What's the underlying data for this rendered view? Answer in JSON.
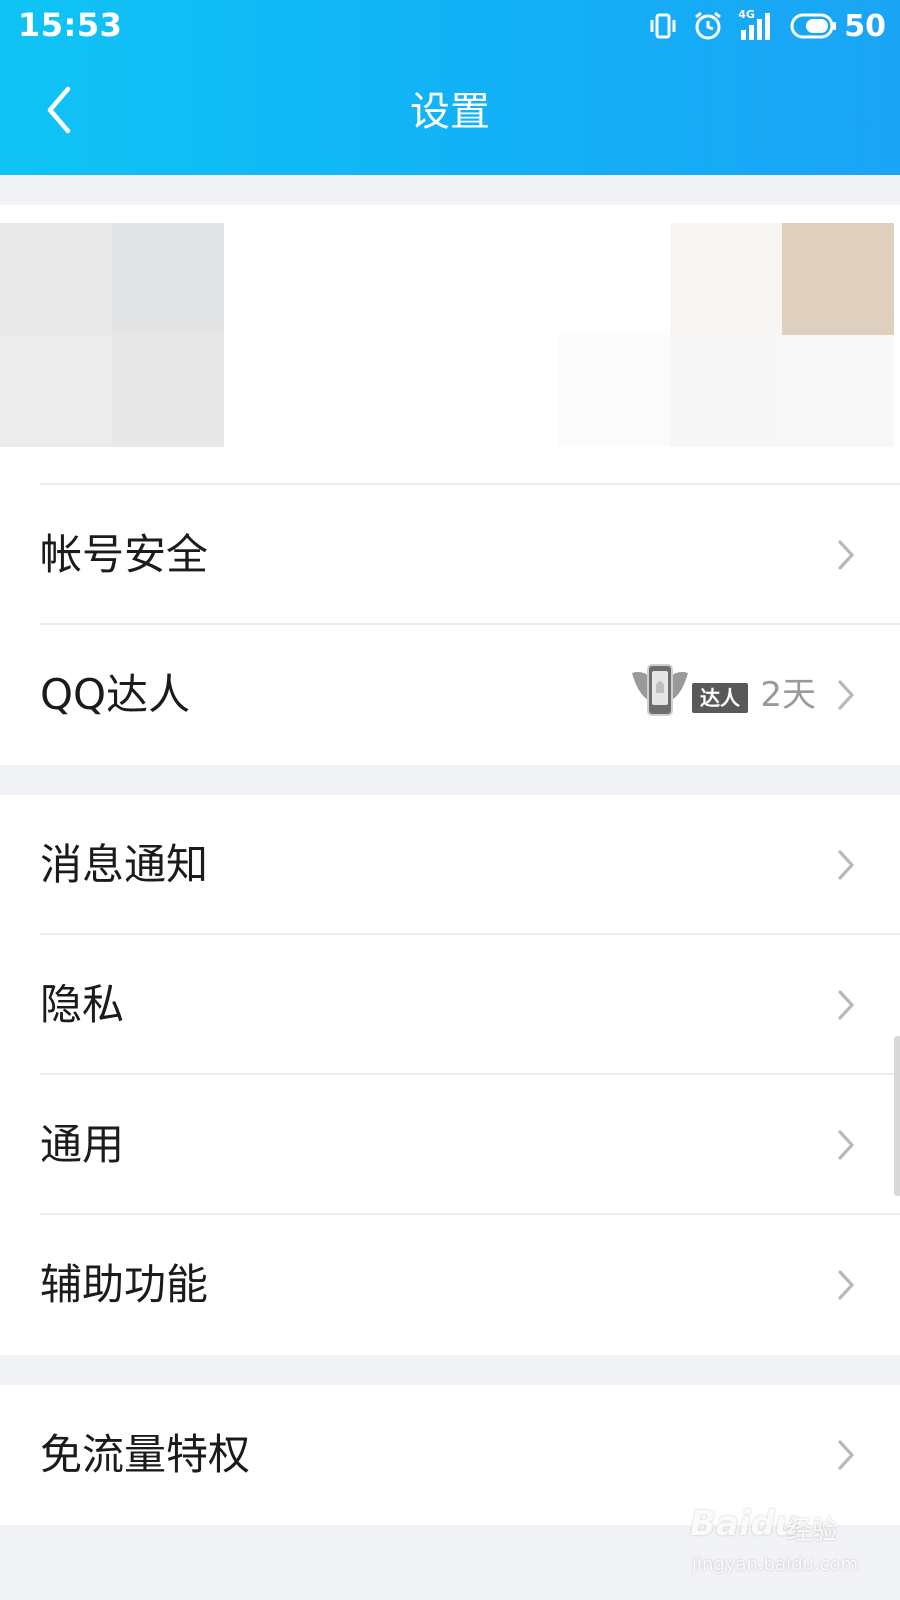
{
  "status_bar": {
    "time": "15:53",
    "network": "4G",
    "battery": "50",
    "icons": [
      "vibrate-icon",
      "alarm-icon",
      "signal-icon",
      "battery-icon"
    ]
  },
  "nav": {
    "title": "设置",
    "back_icon": "chevron-left-icon"
  },
  "profile": {
    "blurred": true
  },
  "section1": {
    "items": [
      {
        "label": "帐号安全"
      },
      {
        "label": "QQ达人",
        "badge": "达人",
        "value": "2天"
      }
    ]
  },
  "section2": {
    "items": [
      {
        "label": "消息通知"
      },
      {
        "label": "隐私"
      },
      {
        "label": "通用"
      },
      {
        "label": "辅助功能"
      }
    ]
  },
  "section3": {
    "items": [
      {
        "label": "免流量特权"
      }
    ]
  },
  "watermark": {
    "brand": "Baidu",
    "suffix": "经验",
    "url": "jingyan.baidu.com"
  },
  "colors": {
    "header_start": "#0fc4f5",
    "header_end": "#1aa4f5",
    "background": "#f2f3f6",
    "text": "#1b1b1b",
    "secondary_text": "#9a9a9a"
  }
}
